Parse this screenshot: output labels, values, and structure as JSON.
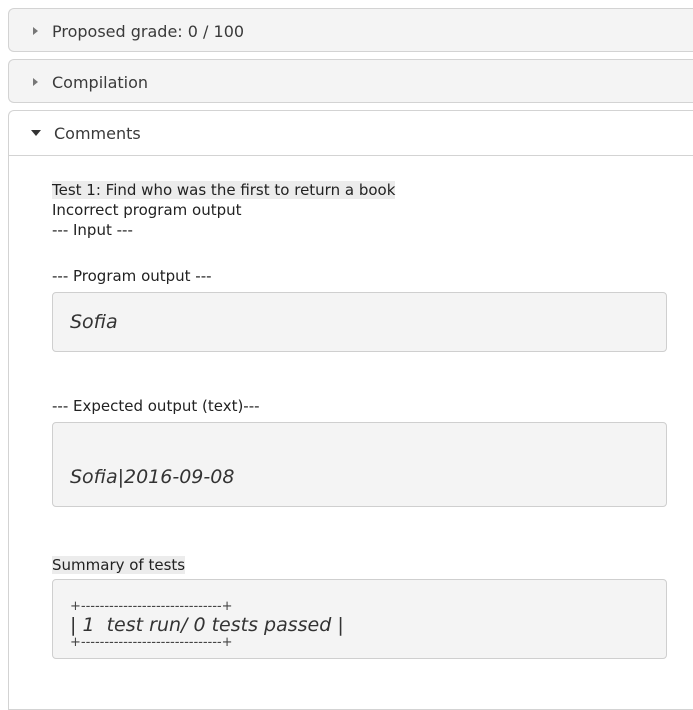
{
  "sections": {
    "grade_label": "Proposed grade: 0 / 100",
    "compilation_label": "Compilation",
    "comments_label": "Comments"
  },
  "comments": {
    "test_title": "Test 1: Find who was the first to return a book",
    "result": "Incorrect program output",
    "input_header": "--- Input ---",
    "program_output_header": "--- Program output ---",
    "program_output": "Sofia",
    "expected_header": "--- Expected output (text)---",
    "expected_output": "Sofia|2016-09-08",
    "summary_header": "Summary of tests",
    "summary_border_top": "+------------------------------+",
    "summary_text": "| 1  test run/ 0 tests passed |",
    "summary_border_bottom": "+------------------------------+"
  }
}
